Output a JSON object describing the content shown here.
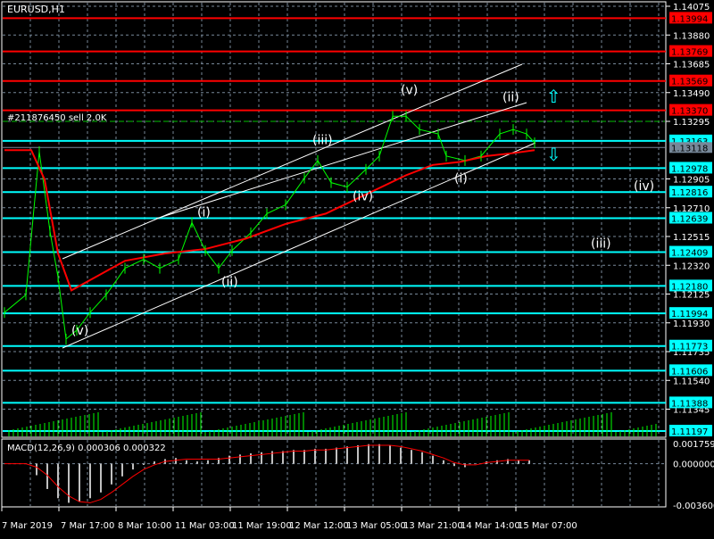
{
  "window": {
    "title": "EURUSD,H1"
  },
  "trade_label": "#211876450 sell 2.0K",
  "colors": {
    "bg": "#000000",
    "axis": "#ffffff",
    "grid": "#778899",
    "red_level": "#ff0000",
    "cyan_level": "#00ffff",
    "price": "#00ff00",
    "ma_red": "#ff0000",
    "ma_blue": "#0000ff",
    "channel": "#ffffff",
    "bid": "#778899",
    "macd_hist": "#c0c0c0",
    "macd_signal": "#ff0000"
  },
  "price_axis": {
    "max": 1.14075,
    "min": 1.11197,
    "ticks": [
      "1.14075",
      "1.13880",
      "1.13685",
      "1.13490",
      "1.13295",
      "1.12905",
      "1.12710",
      "1.12515",
      "1.12320",
      "1.12125",
      "1.11930",
      "1.11735",
      "1.11540",
      "1.11345"
    ]
  },
  "levels": {
    "red": [
      "1.13994",
      "1.13769",
      "1.13569",
      "1.13370"
    ],
    "cyan": [
      "1.13163",
      "1.12978",
      "1.12816",
      "1.12639",
      "1.12409",
      "1.12180",
      "1.11994",
      "1.11773",
      "1.11606",
      "1.11388",
      "1.11197"
    ],
    "bid": "1.13118"
  },
  "wave_labels": [
    {
      "text": "(v)",
      "price": 1.1185,
      "bar": 25
    },
    {
      "text": "(i)",
      "price": 1.1265,
      "bar": 72
    },
    {
      "text": "(ii)",
      "price": 1.1218,
      "bar": 81
    },
    {
      "text": "(iii)",
      "price": 1.1314,
      "bar": 115
    },
    {
      "text": "(iv)",
      "price": 1.1276,
      "bar": 130
    },
    {
      "text": "(v)",
      "price": 1.1348,
      "bar": 148
    },
    {
      "text": "(i)",
      "price": 1.1288,
      "bar": 168
    },
    {
      "text": "(ii)",
      "price": 1.1343,
      "bar": 186
    },
    {
      "text": "(iv)",
      "price": 1.1283,
      "bar": 235
    },
    {
      "text": "(iii)",
      "price": 1.1244,
      "bar": 219
    }
  ],
  "chart_data": {
    "type": "line",
    "symbol": "EURUSD",
    "timeframe": "H1",
    "x_tick_labels": [
      "7 Mar 2019",
      "7 Mar 17:00",
      "8 Mar 10:00",
      "11 Mar 03:00",
      "11 Mar 19:00",
      "12 Mar 12:00",
      "13 Mar 05:00",
      "13 Mar 21:00",
      "14 Mar 14:00",
      "15 Mar 07:00"
    ],
    "price_series": {
      "bars": [
        0,
        8,
        13,
        17,
        20,
        23,
        27,
        32,
        38,
        45,
        52,
        58,
        65,
        70,
        75,
        80,
        85,
        92,
        98,
        105,
        112,
        117,
        122,
        128,
        135,
        140,
        145,
        150,
        155,
        162,
        165,
        172,
        178,
        185,
        190,
        195,
        198
      ],
      "values": [
        1.12,
        1.1212,
        1.1309,
        1.1255,
        1.1224,
        1.1182,
        1.1188,
        1.12,
        1.1212,
        1.123,
        1.1236,
        1.123,
        1.1236,
        1.1261,
        1.1242,
        1.123,
        1.1242,
        1.1254,
        1.1267,
        1.1273,
        1.1291,
        1.1303,
        1.1288,
        1.1285,
        1.1297,
        1.1306,
        1.1333,
        1.1333,
        1.1324,
        1.1321,
        1.1306,
        1.1303,
        1.1306,
        1.1321,
        1.1324,
        1.1321,
        1.1315
      ]
    },
    "ma_series": {
      "bars": [
        0,
        10,
        15,
        20,
        25,
        35,
        45,
        60,
        75,
        90,
        105,
        120,
        135,
        150,
        160,
        170,
        180,
        190,
        198
      ],
      "values": [
        1.131,
        1.131,
        1.129,
        1.124,
        1.1215,
        1.1225,
        1.1235,
        1.124,
        1.1243,
        1.125,
        1.126,
        1.1267,
        1.128,
        1.1293,
        1.13,
        1.1302,
        1.1306,
        1.1308,
        1.131
      ]
    },
    "macd": {
      "title": "MACD(12,26,9) 0.000306 0.000322",
      "axis_labels": [
        "0.001759",
        "0.000000",
        "-0.003600"
      ],
      "max": 0.001759,
      "min": -0.0036,
      "hist_bars": [
        0,
        8,
        12,
        16,
        20,
        24,
        28,
        32,
        36,
        40,
        44,
        48,
        52,
        56,
        60,
        64,
        68,
        72,
        76,
        80,
        84,
        88,
        92,
        96,
        100,
        104,
        108,
        112,
        116,
        120,
        124,
        128,
        132,
        136,
        140,
        144,
        148,
        152,
        156,
        160,
        164,
        168,
        172,
        176,
        180,
        184,
        188,
        192,
        196
      ],
      "hist": [
        0,
        0,
        -0.001,
        -0.0022,
        -0.003,
        -0.0034,
        -0.0033,
        -0.003,
        -0.0025,
        -0.0018,
        -0.0011,
        -0.0005,
        -0.0001,
        0.0002,
        0.0004,
        0.0005,
        0.0003,
        0.0002,
        0.0003,
        0.0005,
        0.0007,
        0.0008,
        0.0009,
        0.001,
        0.0011,
        0.0011,
        0.0012,
        0.0012,
        0.0013,
        0.0013,
        0.0014,
        0.0015,
        0.0016,
        0.0017,
        0.0017,
        0.0016,
        0.0014,
        0.0012,
        0.001,
        0.0007,
        0.0003,
        -0.0002,
        -0.0003,
        0.0,
        0.0002,
        0.0003,
        0.0004,
        0.0003,
        0.0003
      ],
      "signal": [
        0,
        0,
        -0.0003,
        -0.001,
        -0.002,
        -0.0028,
        -0.0033,
        -0.0034,
        -0.0031,
        -0.0025,
        -0.0018,
        -0.0011,
        -0.0005,
        -0.0001,
        0.0002,
        0.0003,
        0.0004,
        0.0004,
        0.0004,
        0.0004,
        0.0005,
        0.0006,
        0.0007,
        0.0008,
        0.0009,
        0.001,
        0.0011,
        0.0011,
        0.0012,
        0.0012,
        0.0013,
        0.0014,
        0.0015,
        0.0016,
        0.0016,
        0.0016,
        0.0015,
        0.0013,
        0.0011,
        0.0008,
        0.0005,
        0.0001,
        -0.0001,
        -0.0001,
        0.0001,
        0.0002,
        0.0003,
        0.0003,
        0.0003
      ]
    }
  }
}
